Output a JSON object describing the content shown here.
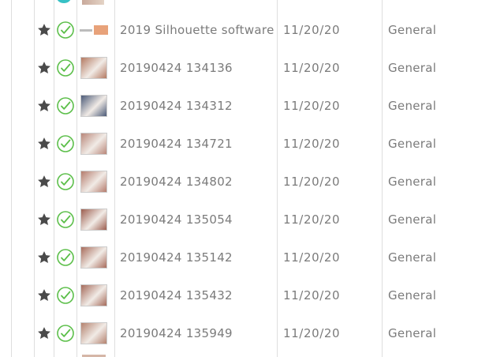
{
  "table": {
    "rows": [
      {
        "name": "2019 Silhouette software",
        "date": "11/20/20",
        "type": "General",
        "starred": true,
        "thumb_color": "#e8a27a",
        "thumb_style": "banner",
        "icon": "check-circle-icon",
        "accent": "#5cbf4a"
      },
      {
        "name": "20190424 134136",
        "date": "11/20/20",
        "type": "General",
        "starred": true,
        "thumb_color": "#b47a62",
        "thumb_style": "photo",
        "icon": "check-circle-icon",
        "accent": "#5cbf4a"
      },
      {
        "name": "20190424 134312",
        "date": "11/20/20",
        "type": "General",
        "starred": true,
        "thumb_color": "#4b5a78",
        "thumb_style": "photo",
        "icon": "check-circle-icon",
        "accent": "#5cbf4a"
      },
      {
        "name": "20190424 134721",
        "date": "11/20/20",
        "type": "General",
        "starred": true,
        "thumb_color": "#b9877a",
        "thumb_style": "photo",
        "icon": "check-circle-icon",
        "accent": "#5cbf4a"
      },
      {
        "name": "20190424 134802",
        "date": "11/20/20",
        "type": "General",
        "starred": true,
        "thumb_color": "#b57c6d",
        "thumb_style": "photo",
        "icon": "check-circle-icon",
        "accent": "#5cbf4a"
      },
      {
        "name": "20190424 135054",
        "date": "11/20/20",
        "type": "General",
        "starred": true,
        "thumb_color": "#9c5e4f",
        "thumb_style": "photo",
        "icon": "check-circle-icon",
        "accent": "#5cbf4a"
      },
      {
        "name": "20190424 135142",
        "date": "11/20/20",
        "type": "General",
        "starred": true,
        "thumb_color": "#a86c5c",
        "thumb_style": "photo",
        "icon": "check-circle-icon",
        "accent": "#5cbf4a"
      },
      {
        "name": "20190424 135432",
        "date": "11/20/20",
        "type": "General",
        "starred": true,
        "thumb_color": "#a56b5b",
        "thumb_style": "photo",
        "icon": "check-circle-icon",
        "accent": "#5cbf4a"
      },
      {
        "name": "20190424 135949",
        "date": "11/20/20",
        "type": "General",
        "starred": true,
        "thumb_color": "#b4826f",
        "thumb_style": "photo",
        "icon": "check-circle-icon",
        "accent": "#5cbf4a"
      }
    ]
  },
  "icons": {
    "star": "star-icon",
    "check": "check-circle-icon"
  },
  "colors": {
    "star": "#4a4a4a",
    "check": "#5cbf4a",
    "text": "#7b7b7b",
    "grid": "#dedede",
    "top_accent": "#36c1c5"
  }
}
